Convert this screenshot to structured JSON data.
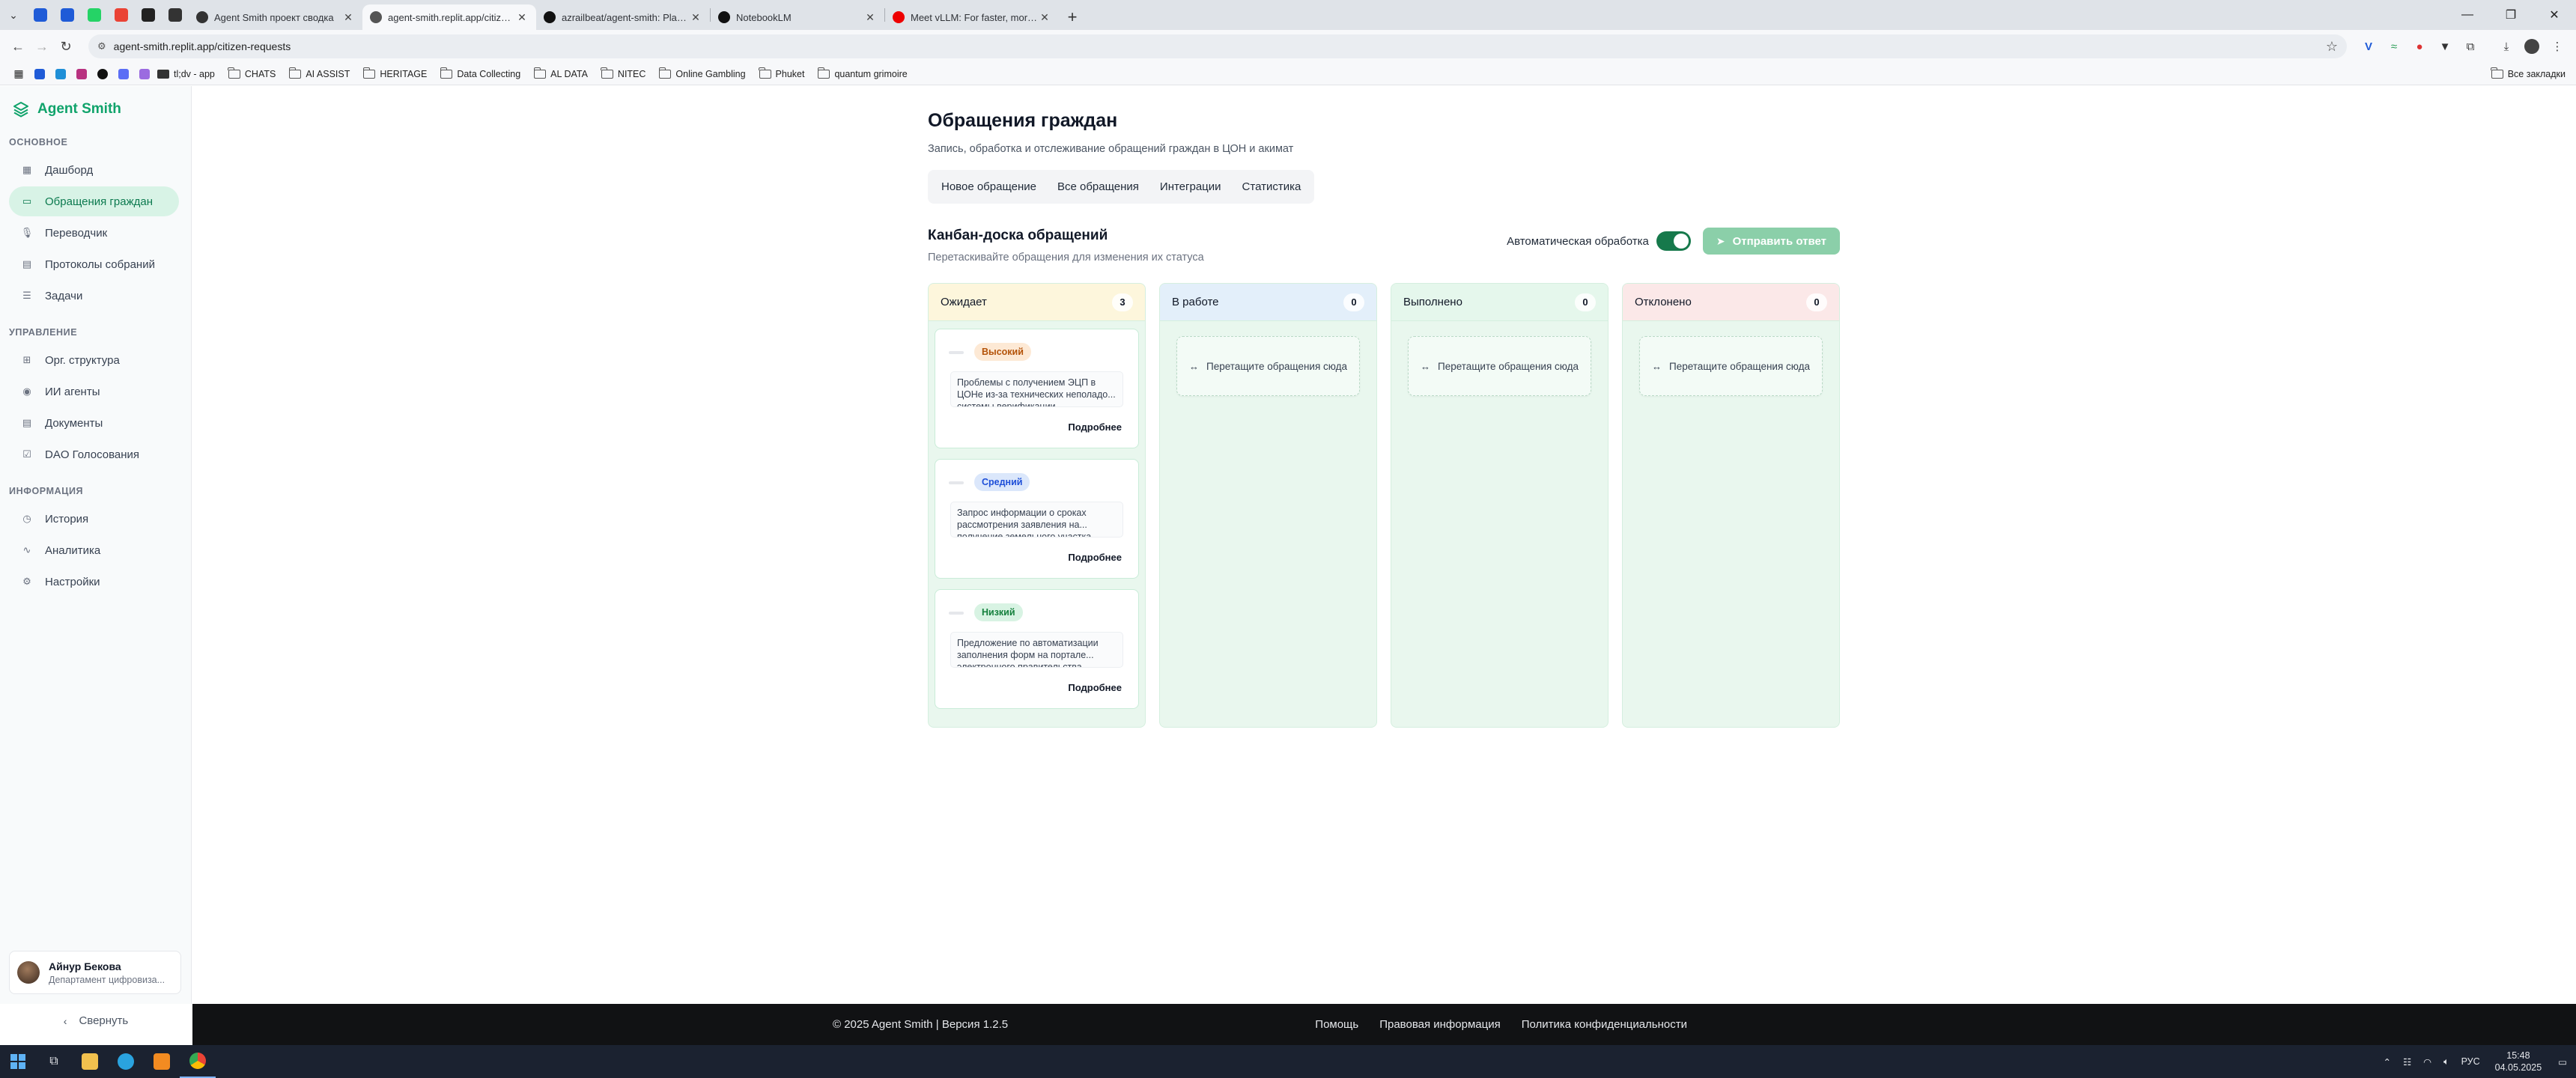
{
  "browser": {
    "pinned_tabs": [
      {
        "icon": "vivaldi-icon",
        "color": "#1f5bd7"
      },
      {
        "icon": "vivaldi-icon",
        "color": "#1f5bd7"
      },
      {
        "icon": "whatsapp-icon",
        "color": "#25d366"
      },
      {
        "icon": "gmail-icon",
        "color": "#ea4335"
      },
      {
        "icon": "tiktok-icon",
        "color": "#222222"
      },
      {
        "icon": "notion-icon",
        "color": "#333333"
      }
    ],
    "tabs": [
      {
        "title": "Agent Smith проект сводка",
        "active": false,
        "color": "#333333"
      },
      {
        "title": "agent-smith.replit.app/citizen-requests",
        "active": true,
        "color": "#555555"
      },
      {
        "title": "azrailbeat/agent-smith: Platform",
        "active": false,
        "color": "#111111"
      },
      {
        "title": "NotebookLM",
        "active": false,
        "color": "#111111"
      },
      {
        "title": "Meet vLLM: For faster, more effi",
        "active": false,
        "color": "#ee0000"
      }
    ],
    "url": "agent-smith.replit.app/citizen-requests",
    "bookmarks": [
      {
        "label": "tl;dv - app",
        "type": "link"
      },
      {
        "label": "CHATS",
        "type": "folder"
      },
      {
        "label": "AI ASSIST",
        "type": "folder"
      },
      {
        "label": "HERITAGE",
        "type": "folder"
      },
      {
        "label": "Data Collecting",
        "type": "folder"
      },
      {
        "label": "AL DATA",
        "type": "folder"
      },
      {
        "label": "NITEC",
        "type": "folder"
      },
      {
        "label": "Online Gambling",
        "type": "folder"
      },
      {
        "label": "Phuket",
        "type": "folder"
      },
      {
        "label": "quantum grimoire",
        "type": "folder"
      }
    ],
    "all_bookmarks": "Все закладки"
  },
  "sidebar": {
    "brand": "Agent Smith",
    "sections": [
      {
        "label": "ОСНОВНОЕ",
        "items": [
          {
            "label": "Дашборд",
            "icon": "dashboard-icon",
            "active": false
          },
          {
            "label": "Обращения граждан",
            "icon": "message-icon",
            "active": true
          },
          {
            "label": "Переводчик",
            "icon": "mic-icon",
            "active": false
          },
          {
            "label": "Протоколы собраний",
            "icon": "file-icon",
            "active": false
          },
          {
            "label": "Задачи",
            "icon": "tasks-icon",
            "active": false
          }
        ]
      },
      {
        "label": "УПРАВЛЕНИЕ",
        "items": [
          {
            "label": "Орг. структура",
            "icon": "org-icon",
            "active": false
          },
          {
            "label": "ИИ агенты",
            "icon": "robot-icon",
            "active": false
          },
          {
            "label": "Документы",
            "icon": "document-icon",
            "active": false
          },
          {
            "label": "DAO Голосования",
            "icon": "vote-icon",
            "active": false
          }
        ]
      },
      {
        "label": "ИНФОРМАЦИЯ",
        "items": [
          {
            "label": "История",
            "icon": "history-icon",
            "active": false
          },
          {
            "label": "Аналитика",
            "icon": "analytics-icon",
            "active": false
          },
          {
            "label": "Настройки",
            "icon": "settings-icon",
            "active": false
          }
        ]
      }
    ],
    "profile": {
      "name": "Айнур Бекова",
      "dept": "Департамент цифровиза..."
    },
    "collapse": "Свернуть"
  },
  "page": {
    "title": "Обращения граждан",
    "subtitle": "Запись, обработка и отслеживание обращений граждан в ЦОН и акимат",
    "tabs": [
      "Новое обращение",
      "Все обращения",
      "Интеграции",
      "Статистика"
    ],
    "board_title": "Канбан-доска обращений",
    "board_subtitle": "Перетаскивайте обращения для изменения их статуса",
    "auto_label": "Автоматическая обработка",
    "send_label": "Отправить ответ",
    "drop_text": "Перетащите обращения сюда",
    "more_label": "Подробнее",
    "columns": [
      {
        "title": "Ожидает",
        "count": "3",
        "header_color": "#fdf6dc",
        "cards": [
          {
            "priority": "Высокий",
            "badge_bg": "#fde9d5",
            "badge_fg": "#b45309",
            "text": "Проблемы с получением ЭЦП в ЦОНе из-за технических неполадо... системы верификации"
          },
          {
            "priority": "Средний",
            "badge_bg": "#dbe7fb",
            "badge_fg": "#1d4ed8",
            "text": "Запрос информации о сроках рассмотрения заявления на... получение земельного участка"
          },
          {
            "priority": "Низкий",
            "badge_bg": "#d8f3e3",
            "badge_fg": "#15803d",
            "text": "Предложение по автоматизации заполнения форм на портале... электронного правительства"
          }
        ]
      },
      {
        "title": "В работе",
        "count": "0",
        "header_color": "#e3effa",
        "cards": []
      },
      {
        "title": "Выполнено",
        "count": "0",
        "header_color": "#e5f7ec",
        "cards": []
      },
      {
        "title": "Отклонено",
        "count": "0",
        "header_color": "#fbe8e8",
        "cards": []
      }
    ]
  },
  "footer": {
    "copyright": "© 2025 Agent Smith | Версия 1.2.5",
    "links": [
      "Помощь",
      "Правовая информация",
      "Политика конфиденциальности"
    ]
  },
  "taskbar": {
    "lang": "РУС",
    "time": "15:48",
    "date": "04.05.2025"
  }
}
